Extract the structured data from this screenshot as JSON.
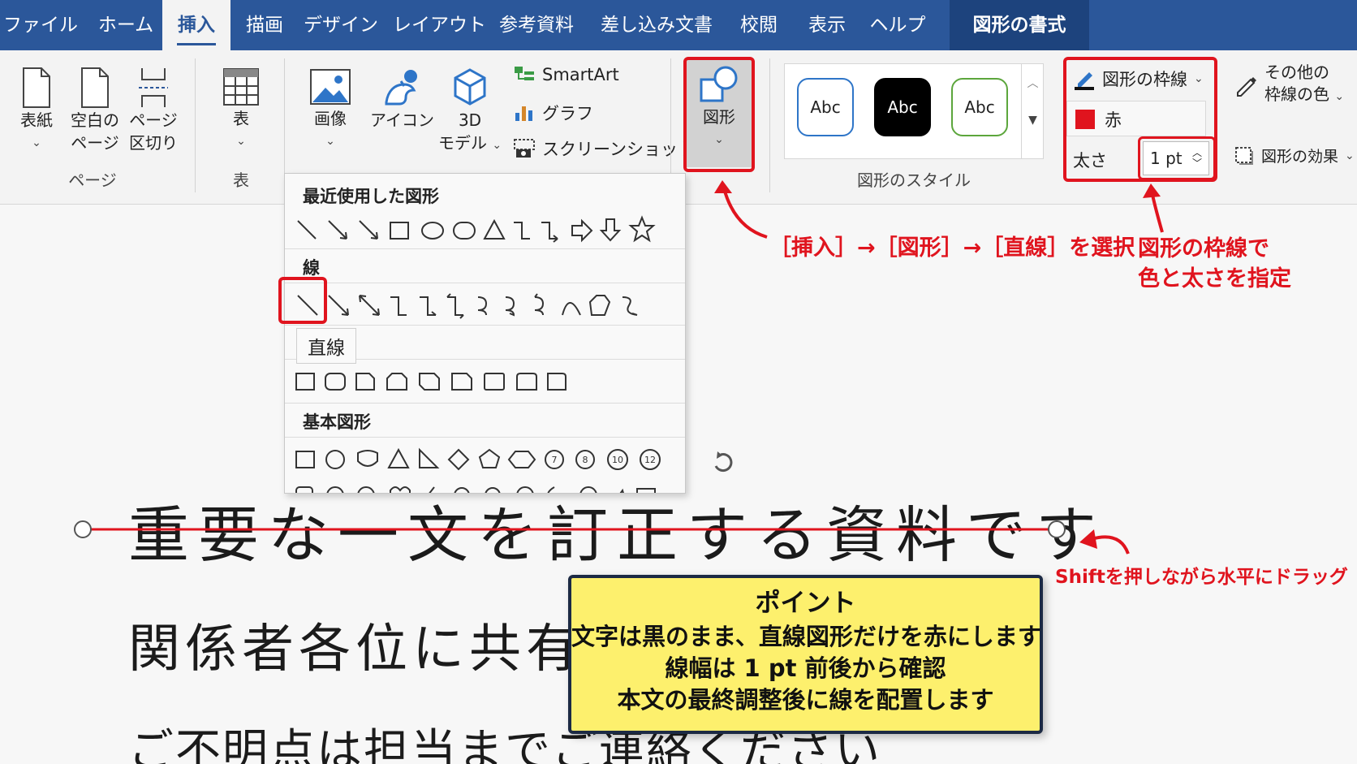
{
  "tabs": {
    "file": "ファイル",
    "home": "ホーム",
    "insert": "挿入",
    "draw": "描画",
    "design": "デザイン",
    "layout": "レイアウト",
    "references": "参考資料",
    "mailings": "差し込み文書",
    "review": "校閲",
    "view": "表示",
    "help": "ヘルプ",
    "shape_format": "図形の書式"
  },
  "ribbon": {
    "pages": {
      "cover": "表紙",
      "blank_line1": "空白の",
      "blank_line2": "ページ",
      "break_line1": "ページ",
      "break_line2": "区切り",
      "group": "ページ"
    },
    "table": {
      "button": "表",
      "group": "表"
    },
    "illustrations": {
      "picture": "画像",
      "icons": "アイコン",
      "model_line1": "3D",
      "model_line2": "モデル",
      "smartart": "SmartArt",
      "chart": "グラフ",
      "screenshot": "スクリーンショット",
      "shapes": "図形"
    },
    "styles": {
      "sample1": "Abc",
      "sample2": "Abc",
      "sample3": "Abc",
      "group": "図形のスタイル"
    },
    "outline": {
      "label": "図形の枠線",
      "color_name": "赤",
      "weight_label": "太さ",
      "weight_value": "1 pt",
      "other_colors_line1": "その他の",
      "other_colors_line2": "枠線の色",
      "effects": "図形の効果"
    }
  },
  "shape_menu": {
    "recent_heading": "最近使用した図形",
    "lines_heading": "線",
    "basic_heading": "基本図形",
    "tooltip": "直線",
    "basic_numbers": [
      "7",
      "8",
      "10",
      "12"
    ]
  },
  "document": {
    "line1": "重要な一文を訂正する資料です",
    "line2": "関係者各位に共有して",
    "line3": "ご不明点は担当までご連絡ください"
  },
  "annotations": {
    "step_label": "［挿入］→［図形］→［直線］を選択",
    "outline_note_line1": "図形の枠線で",
    "outline_note_line2": "色と太さを指定",
    "drag_note": "Shiftを押しながら水平にドラッグ"
  },
  "point_box": {
    "title": "ポイント",
    "line1": "文字は黒のまま、直線図形だけを赤にします",
    "line2": "線幅は 1 pt 前後から確認",
    "line3": "本文の最終調整後に線を配置します"
  },
  "colors": {
    "tab_bar": "#2b579a",
    "accent_red": "#e0141e",
    "note_yellow": "#fdf06d"
  }
}
